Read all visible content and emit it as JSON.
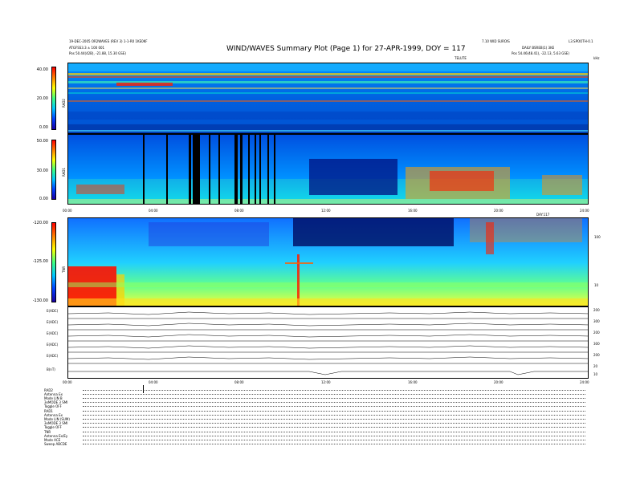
{
  "header": {
    "title": "WIND/WAVES Summary Plot (Page 1) for 27-APR-1999, DOY = 117",
    "left_line1": "19-DEC-2005 OR2WAVES (REV 3) 1-1-R0 1KE0KF",
    "left_line2": "ATGFSS3.3 ± 100 001",
    "left_pos": "Pos    50.44(42B), -21.88, 15.30 GSE)",
    "right_line1": "7.10 WID SUROIS",
    "right_line2": "DAILY BSREB(1) 3KE",
    "right_pos": "Pos    54.46(48.41), -22.13, 5.63 GSE)",
    "right_top": "L3.SPOOTH-0.1",
    "time_label": "TELUTE",
    "unit_top_right": "kHz"
  },
  "panel_rad2": {
    "name": "RAD2",
    "yticks": [
      "40.00",
      "20.00",
      "0.00"
    ]
  },
  "panel_rad1": {
    "name": "RAD1",
    "yticks": [
      "50.00",
      "30.00",
      "0.00"
    ]
  },
  "time_axis_1": {
    "ticks": [
      "00:00",
      "04:00",
      "08:00",
      "12:00",
      "16:00",
      "20:00",
      "24:00"
    ],
    "right_label": "DAY:117"
  },
  "panel_tnr": {
    "name": "TNR",
    "yticks": [
      "-120.00",
      "-125.00",
      "-130.00"
    ],
    "right_ticks": [
      "100",
      "10"
    ]
  },
  "traces": {
    "labels": [
      "E(ADC)",
      "E(ADC)",
      "E(ADC)",
      "E(ADC)",
      "E(ADC)",
      "B(nT)"
    ],
    "right_ticks": [
      "200",
      "300",
      "200",
      "300",
      "200",
      "20",
      "10"
    ]
  },
  "time_axis_2": {
    "ticks": [
      "00:00",
      "04:00",
      "08:00",
      "12:00",
      "16:00",
      "20:00",
      "24:00"
    ]
  },
  "status_block": {
    "rows": [
      "RAD2",
      "Antenna   Ex",
      "Mode    LIN B",
      "3xMODE 3 SMI",
      "Toggle    OFF",
      "RAD1",
      "Antenna   Ex",
      "Mode  LIN (SUM)",
      "3xMODE 3 SMI",
      "Toggle    OFF",
      "TNR",
      "Antenna   Ex/Ey",
      "Mode     ACE",
      "Sweep  ABCDE"
    ]
  }
}
